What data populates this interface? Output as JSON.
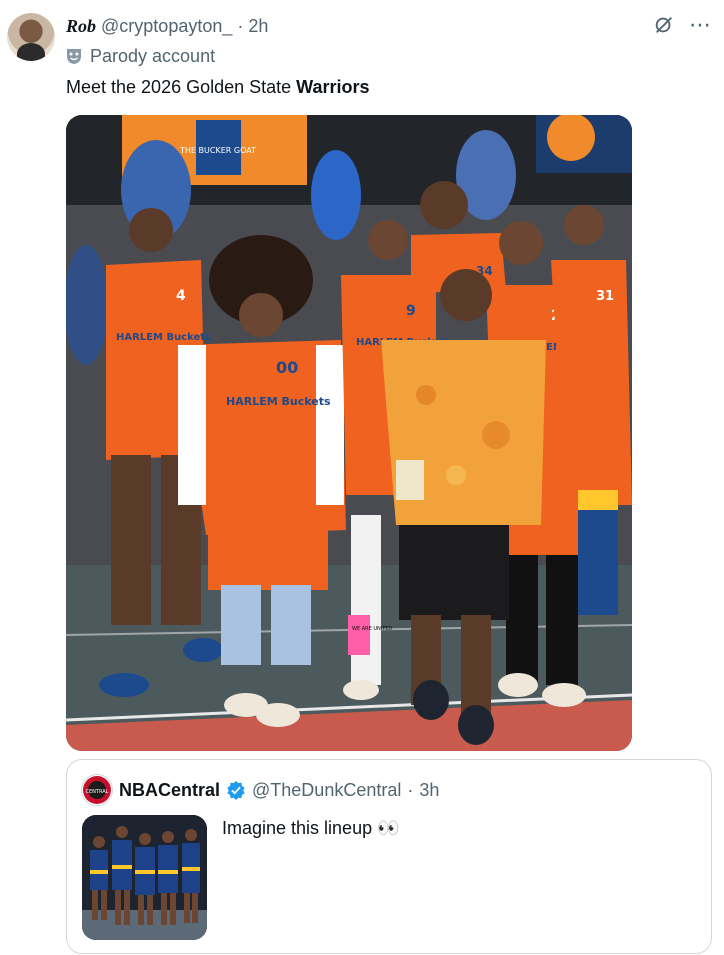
{
  "post": {
    "display_name": "Rob",
    "handle": "@cryptopayton_",
    "separator": "·",
    "time": "2h",
    "parody_label": "Parody account",
    "text_prefix": "Meet the 2026 Golden State ",
    "text_bold": "Warriors",
    "icons": [
      "grok-icon",
      "more-icon",
      "parody-mask-icon"
    ]
  },
  "photo": {
    "sign_text": "THE BUCKER GOAT",
    "jersey_team": "HARLEM Buckets",
    "jersey_numbers": [
      "4",
      "00",
      "9",
      "34",
      "2",
      "31"
    ],
    "sock_text": "WE ARE UNITED"
  },
  "quote": {
    "display_name": "NBACentral",
    "handle": "@TheDunkCentral",
    "separator": "·",
    "time": "3h",
    "text": "Imagine this lineup 👀",
    "avatar_text": "CENTRAL"
  },
  "colors": {
    "text": "#0f1419",
    "muted": "#536471",
    "border": "#cfd9de",
    "verified": "#1d9bf0",
    "jersey_orange": "#f0621f",
    "warriors_blue": "#1d428a",
    "warriors_gold": "#ffc72c"
  }
}
